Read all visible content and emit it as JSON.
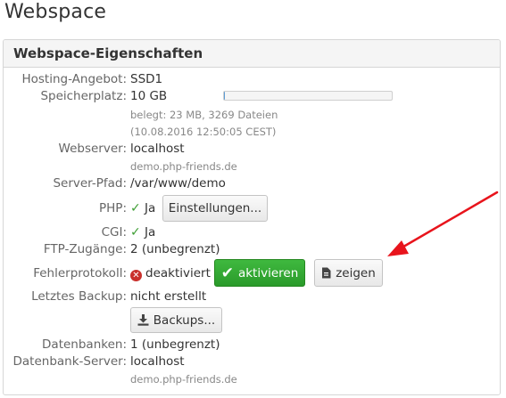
{
  "page": {
    "title": "Webspace"
  },
  "panel": {
    "heading": "Webspace-Eigenschaften",
    "hosting": {
      "label": "Hosting-Angebot:",
      "value": "SSD1"
    },
    "storage": {
      "label": "Speicherplatz:",
      "value": "10 GB",
      "usage_fraction": 0.0023,
      "detail_line1": "belegt: 23 MB, 3269 Dateien",
      "detail_line2": "(10.08.2016 12:50:05 CEST)"
    },
    "webserver": {
      "label": "Webserver:",
      "value": "localhost",
      "sub": "demo.php-friends.de"
    },
    "server_path": {
      "label": "Server-Pfad:",
      "value": "/var/www/demo"
    },
    "php": {
      "label": "PHP:",
      "value": "Ja",
      "button": "Einstellungen..."
    },
    "cgi": {
      "label": "CGI:",
      "value": "Ja"
    },
    "ftp": {
      "label": "FTP-Zugänge:",
      "value": "2 (unbegrenzt)"
    },
    "error_log": {
      "label": "Fehlerprotokoll:",
      "status": "deaktiviert",
      "activate_button": "aktivieren",
      "show_button": "zeigen"
    },
    "backup": {
      "label": "Letztes Backup:",
      "value": "nicht erstellt",
      "button": "Backups..."
    },
    "databases": {
      "label": "Datenbanken:",
      "value": "1 (unbegrenzt)"
    },
    "db_server": {
      "label": "Datenbank-Server:",
      "value": "localhost",
      "sub": "demo.php-friends.de"
    }
  },
  "colors": {
    "accent_green": "#2ea42e",
    "error_red": "#c9302c",
    "annotation_arrow": "#e8141c",
    "progress_fill": "#5b9bd5"
  }
}
